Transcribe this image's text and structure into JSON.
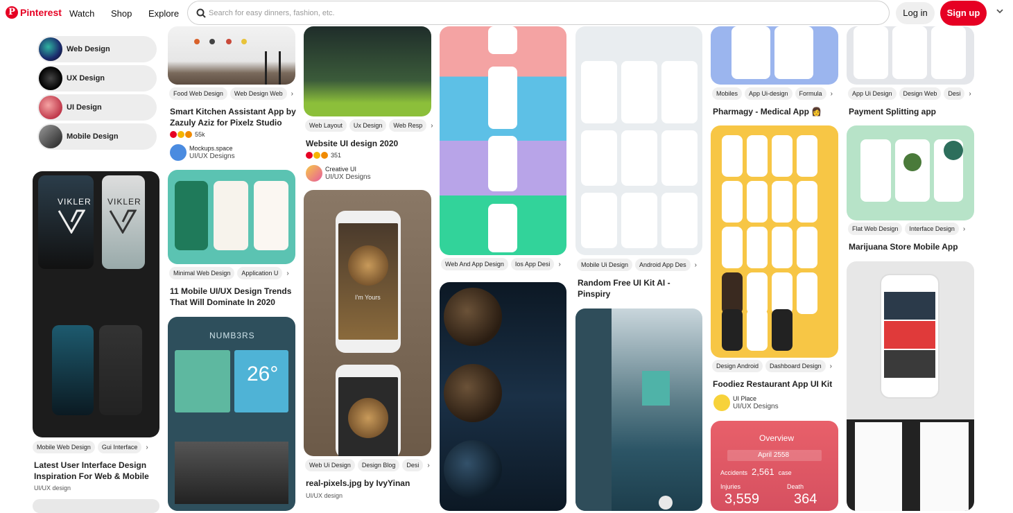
{
  "header": {
    "brand": "Pinterest",
    "nav": [
      "Watch",
      "Shop",
      "Explore"
    ],
    "search_placeholder": "Search for easy dinners, fashion, etc.",
    "login": "Log in",
    "signup": "Sign up"
  },
  "colors": {
    "brand": "#e60023",
    "chip_bg": "#efefef"
  },
  "related": [
    {
      "label": "Web Design"
    },
    {
      "label": "UX Design"
    },
    {
      "label": "UI Design"
    },
    {
      "label": "Mobile Design"
    }
  ],
  "pins": {
    "p1": {
      "chips": [
        "Food Web Design",
        "Web Design Web"
      ],
      "title": "Smart Kitchen Assistant App by Zazuly Aziz for Pixelz Studio",
      "reactions": "55k",
      "author": "Mockups.space",
      "board": "UI/UX Designs"
    },
    "p2": {
      "chips": [
        "Minimal Web Design",
        "Application U"
      ],
      "title": "11 Mobile UI/UX Design Trends That Will Dominate In 2020",
      "image_text": "NUMB3RS",
      "temp": "26°"
    },
    "p3": {
      "chips": [
        "Mobile Web Design",
        "Gui Interface"
      ],
      "title": "Latest User Interface Design Inspiration For Web & Mobile",
      "sub": "UI/UX design",
      "brand1": "VIKLER",
      "brand2": "VIKLER"
    },
    "p4": {
      "chips": [
        "Web Layout",
        "Ux Design",
        "Web Resp"
      ],
      "title": "Website UI design 2020",
      "reactions": "351",
      "author": "Creative UI",
      "board": "UI/UX Designs"
    },
    "p5": {
      "chips": [
        "Web Ui Design",
        "Design Blog",
        "Desi"
      ],
      "title": "real-pixels.jpg by IvyYinan",
      "sub": "UI/UX design",
      "song": "I'm Yours"
    },
    "p6": {
      "chips": [
        "Web And App Design",
        "Ios App Desi"
      ]
    },
    "p7": {
      "chips": [
        "Mobile Ui Design",
        "Android App Des"
      ],
      "title": "Random Free UI Kit AI - Pinspiry"
    },
    "p8": {
      "chips": [
        "Mobiles",
        "App Ui-design",
        "Formula"
      ],
      "title": "Pharmagy - Medical App 👩"
    },
    "p9": {
      "chips": [
        "Design Android",
        "Dashboard Design"
      ],
      "title": "Foodiez Restaurant App UI Kit",
      "author": "UI Place",
      "board": "UI/UX Designs"
    },
    "p10": {
      "overview": "Overview",
      "date": "April 2558",
      "accidents_label": "Accidents",
      "accidents": "2,561",
      "accidents_unit": "case",
      "injuries_label": "Injuries",
      "injuries": "3,559",
      "death_label": "Death",
      "death": "364"
    },
    "p11": {
      "chips": [
        "App Ui Design",
        "Design Web",
        "Desi"
      ],
      "title": "Payment Splitting app"
    },
    "p12": {
      "chips": [
        "Flat Web Design",
        "Interface Design"
      ],
      "title": "Marijuana Store Mobile App"
    }
  }
}
